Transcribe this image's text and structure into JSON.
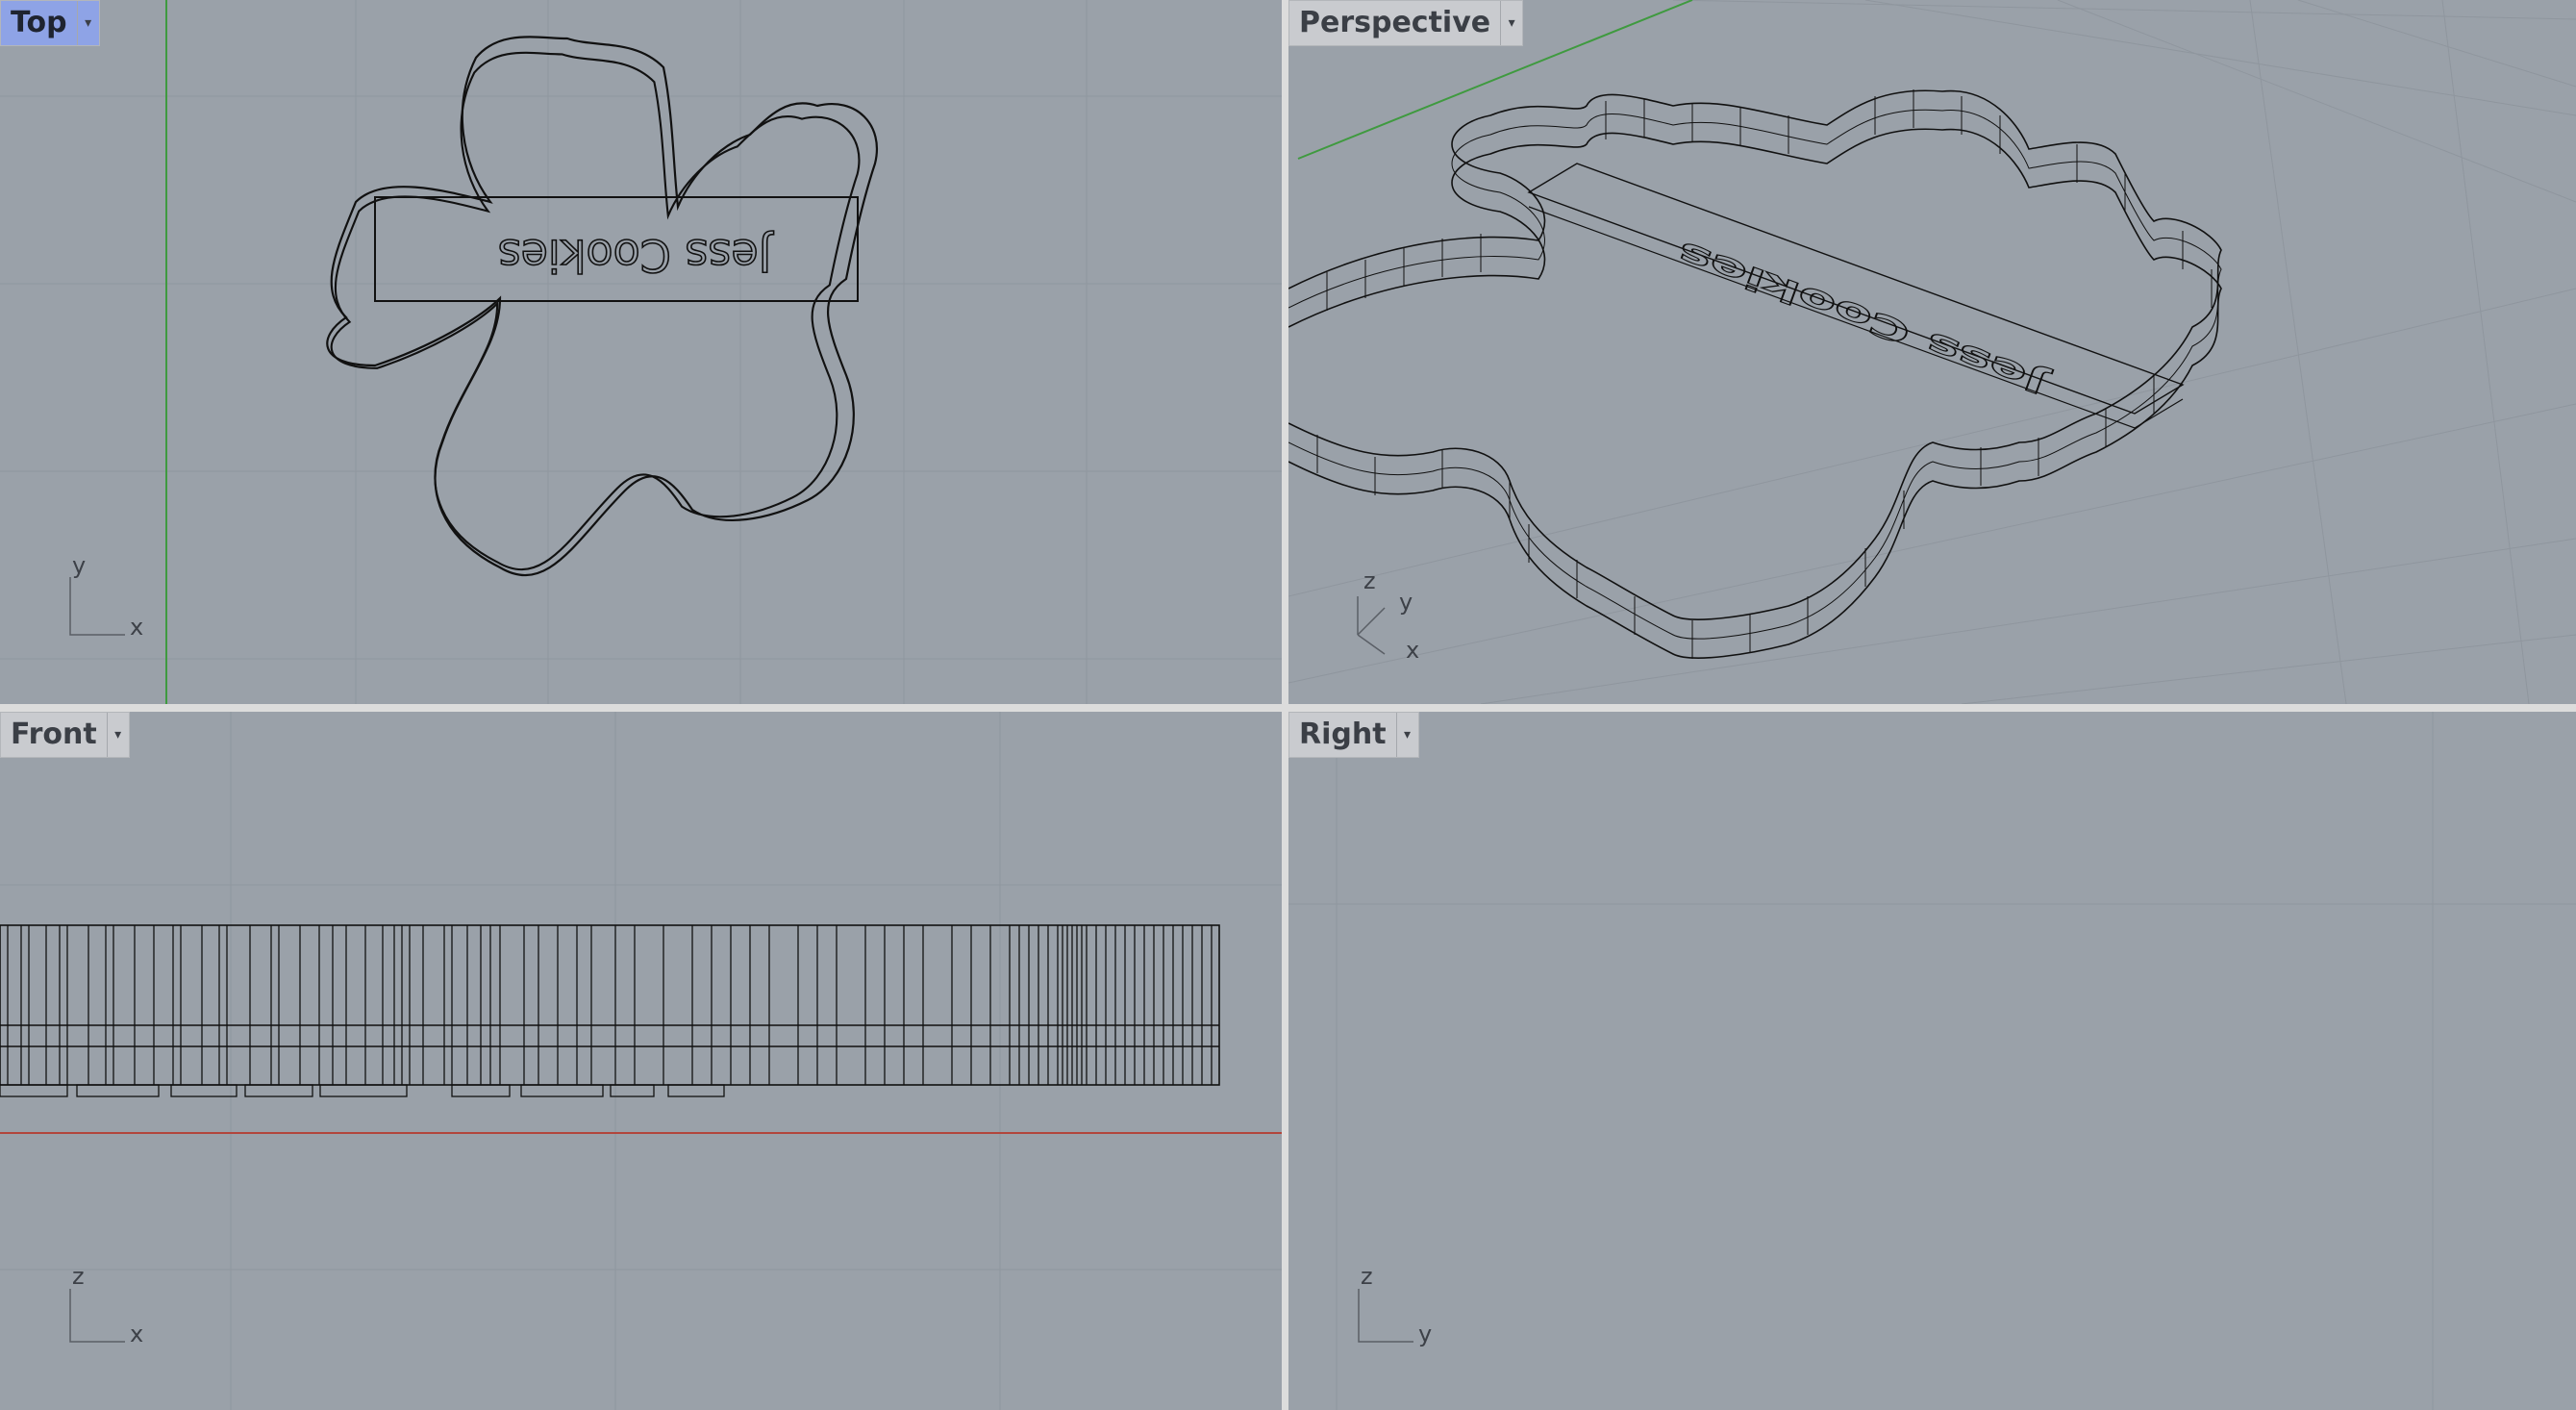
{
  "viewports": {
    "top": {
      "label": "Top",
      "active": true,
      "axes": [
        "y",
        "x"
      ],
      "engraving": "Jess Cookies"
    },
    "perspective": {
      "label": "Perspective",
      "active": false,
      "axes": [
        "z",
        "y",
        "x"
      ],
      "engraving": "Jess Cookies"
    },
    "front": {
      "label": "Front",
      "active": false,
      "axes": [
        "z",
        "x"
      ]
    },
    "right": {
      "label": "Right",
      "active": false,
      "axes": [
        "z",
        "y"
      ]
    }
  },
  "icons": {
    "dropdown": "chevron-down-icon"
  },
  "colors": {
    "viewport_bg": "#9aa1a9",
    "active_tab": "#8ea3e6",
    "grid": "#8f969e",
    "x_axis": "#b2453c",
    "y_axis": "#3f9a3f",
    "wire": "#111111"
  }
}
